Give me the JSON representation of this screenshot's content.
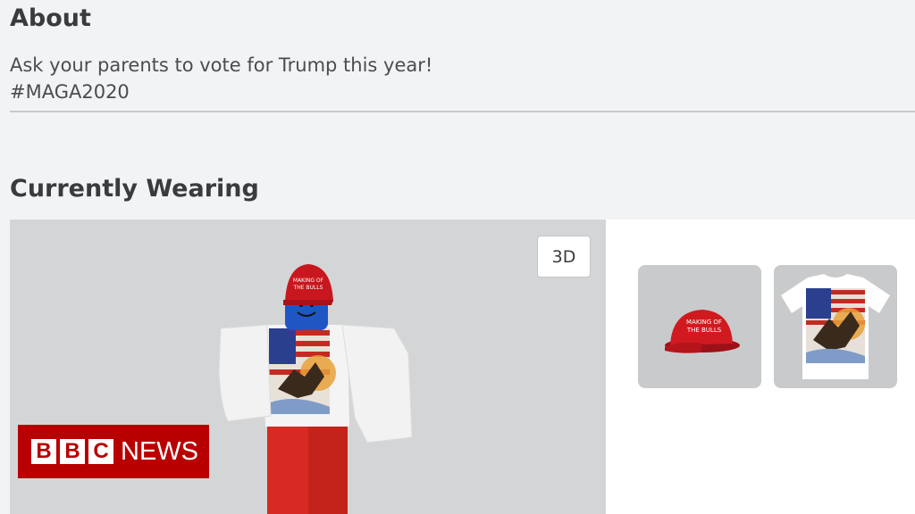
{
  "about": {
    "title": "About",
    "lines": [
      "Ask your parents to vote for Trump this year!",
      "#MAGA2020"
    ]
  },
  "currently_wearing": {
    "title": "Currently Wearing",
    "view_toggle_label": "3D",
    "hat_text": [
      "MAKING OF",
      "THE BULLS"
    ],
    "items": [
      {
        "name": "red-cap"
      },
      {
        "name": "eagle-flag-tshirt"
      }
    ]
  },
  "watermark": {
    "boxes": [
      "B",
      "B",
      "C"
    ],
    "news": "NEWS",
    "color": "#b80000"
  },
  "colors": {
    "page_bg": "#f2f3f5",
    "viewer_bg": "#d4d5d7",
    "card_bg": "#c9cacc",
    "hat_red": "#c8171e"
  }
}
